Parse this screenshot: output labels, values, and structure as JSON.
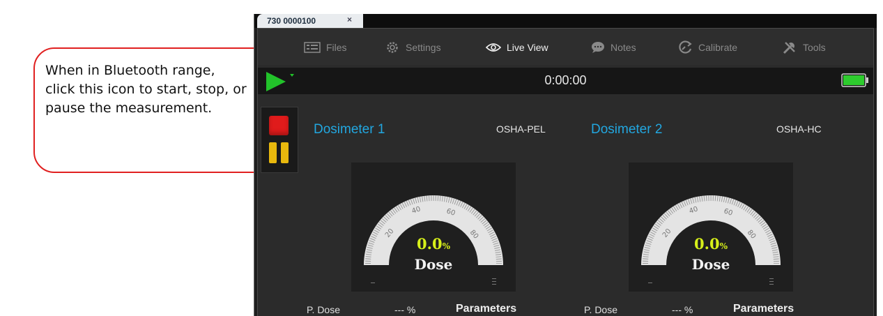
{
  "callout": {
    "text": "When in Bluetooth range, click this icon to start, stop, or pause the measurement."
  },
  "document_tab": {
    "label": "730 0000100",
    "close": "×"
  },
  "menu": [
    {
      "label": "Files",
      "icon": "files-icon"
    },
    {
      "label": "Settings",
      "icon": "gear-icon"
    },
    {
      "label": "Live View",
      "icon": "eye-icon",
      "active": true
    },
    {
      "label": "Notes",
      "icon": "notes-icon"
    },
    {
      "label": "Calibrate",
      "icon": "calibrate-icon"
    },
    {
      "label": "Tools",
      "icon": "tools-icon"
    }
  ],
  "timer": "0:00:00",
  "battery": {
    "icon": "battery-icon",
    "level": 1.0,
    "color": "#2ecc2e"
  },
  "controls": {
    "play_icon": "play-icon",
    "stop_icon": "stop-icon",
    "pause_icon": "pause-icon",
    "play_color": "#22c22a",
    "stop_color": "#e01b1b",
    "pause_color": "#e8b80d"
  },
  "dosimeters": [
    {
      "title": "Dosimeter 1",
      "standard": "OSHA-PEL",
      "gauge": {
        "ticks": [
          "20",
          "40",
          "60",
          "80"
        ],
        "value": "0.0",
        "unit": "%",
        "label": "Dose"
      },
      "p_dose_label": "P. Dose",
      "p_dose_value": "--- %",
      "parameters_title": "Parameters"
    },
    {
      "title": "Dosimeter 2",
      "standard": "OSHA-HC",
      "gauge": {
        "ticks": [
          "20",
          "40",
          "60",
          "80"
        ],
        "value": "0.0",
        "unit": "%",
        "label": "Dose"
      },
      "p_dose_label": "P. Dose",
      "p_dose_value": "--- %",
      "parameters_title": "Parameters"
    }
  ],
  "colors": {
    "accent_blue": "#22a7e0",
    "value_yellow": "#d7f01a",
    "callout_border": "#e02020",
    "background_dark": "#2b2b2b"
  }
}
